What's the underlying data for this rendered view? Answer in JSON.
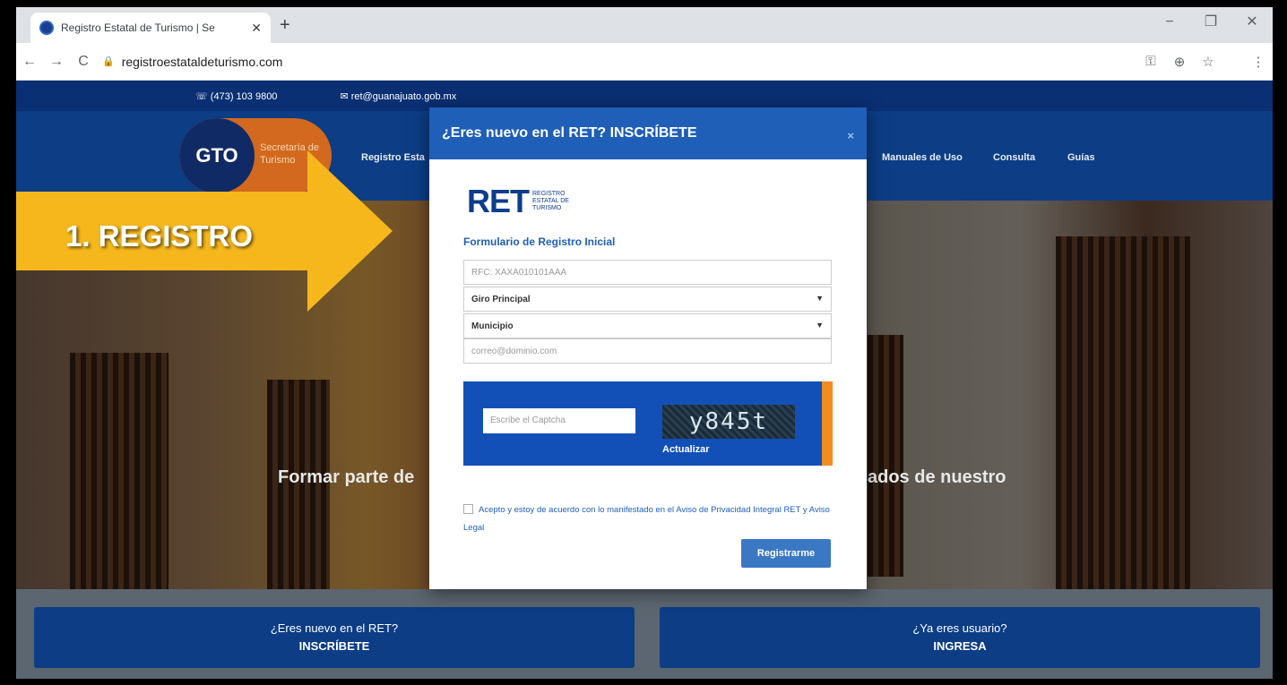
{
  "browser": {
    "tab_title": "Registro Estatal de Turismo | Se",
    "tab_close": "✕",
    "new_tab": "+",
    "url": "registroestataldeturismo.com",
    "window_controls": [
      "−",
      "❐",
      "✕"
    ]
  },
  "topbar": {
    "phone": "☏ (473) 103 9800",
    "email": "✉ ret@guanajuato.gob.mx"
  },
  "header": {
    "logo_text": "GTO",
    "logo_sub": "Secretaría de Turismo",
    "nav": [
      "Registro Esta",
      "Manuales de Uso",
      "Consulta",
      "Guías"
    ]
  },
  "hero": {
    "text_left": "Formar parte de",
    "text_right": "ados de nuestro"
  },
  "overlay": {
    "step_label": "1. REGISTRO"
  },
  "modal": {
    "title": "¿Eres nuevo en el RET? INSCRÍBETE",
    "close": "×",
    "logo_big": "RET",
    "logo_small": "REGISTRO ESTATAL DE TURISMO",
    "form_title": "Formulario de Registro Inicial",
    "rfc_placeholder": "RFC: XAXA010101AAA",
    "giro_label": "Giro Principal",
    "municipio_label": "Municipio",
    "email_placeholder": "correo@dominio.com",
    "captcha_placeholder": "Escribe el Captcha",
    "captcha_text": "y845t",
    "refresh_label": "Actualizar",
    "terms_text": "Acepto y estoy de acuerdo con lo manifestado en el Aviso de Privacidad Integral RET y Aviso Legal",
    "submit_label": "Registrarme"
  },
  "bottom": {
    "new_line1": "¿Eres nuevo en el RET?",
    "new_line2": "INSCRÍBETE",
    "user_line1": "¿Ya eres usuario?",
    "user_line2": "INGRESA"
  },
  "colors": {
    "brand_blue": "#0c3d85",
    "accent_orange": "#f28c1e",
    "arrow_yellow": "#f5b71c"
  }
}
